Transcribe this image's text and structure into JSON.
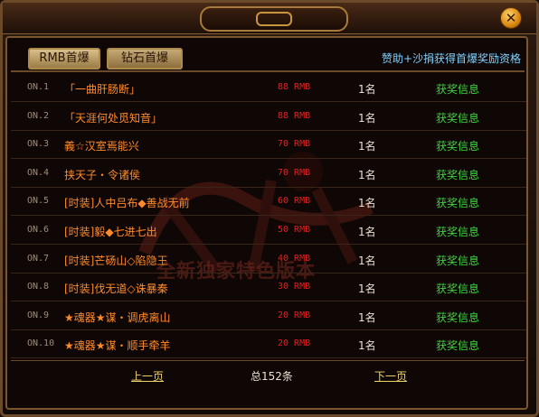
{
  "window": {
    "close_glyph": "✕"
  },
  "tabs": [
    {
      "label": "RMB首爆",
      "active": true
    },
    {
      "label": "钻石首爆",
      "active": false
    }
  ],
  "sponsor_text": "赞助+沙捐获得首爆奖励资格",
  "watermark": "全新独家特色版本",
  "rows": [
    {
      "rank": "ON.1",
      "name": "「一曲肝肠断」",
      "amount": "88 RMB",
      "count": "1名",
      "prize": "获奖信息"
    },
    {
      "rank": "ON.2",
      "name": "「天涯何处觅知音」",
      "amount": "88 RMB",
      "count": "1名",
      "prize": "获奖信息"
    },
    {
      "rank": "ON.3",
      "name": "義☆汉室焉能兴",
      "amount": "70 RMB",
      "count": "1名",
      "prize": "获奖信息"
    },
    {
      "rank": "ON.4",
      "name": "挟天子・令诸侯",
      "amount": "70 RMB",
      "count": "1名",
      "prize": "获奖信息"
    },
    {
      "rank": "ON.5",
      "name": "[时装]人中吕布◆善战无前",
      "amount": "60 RMB",
      "count": "1名",
      "prize": "获奖信息"
    },
    {
      "rank": "ON.6",
      "name": "[时装]毅◆七进七出",
      "amount": "50 RMB",
      "count": "1名",
      "prize": "获奖信息"
    },
    {
      "rank": "ON.7",
      "name": "[时装]芒砀山◇陷隐王",
      "amount": "40 RMB",
      "count": "1名",
      "prize": "获奖信息"
    },
    {
      "rank": "ON.8",
      "name": "[时装]伐无道◇诛暴秦",
      "amount": "30 RMB",
      "count": "1名",
      "prize": "获奖信息"
    },
    {
      "rank": "ON.9",
      "name": "★魂器★谋・调虎离山",
      "amount": "20 RMB",
      "count": "1名",
      "prize": "获奖信息"
    },
    {
      "rank": "ON.10",
      "name": "★魂器★谋・顺手牵羊",
      "amount": "20 RMB",
      "count": "1名",
      "prize": "获奖信息"
    }
  ],
  "pager": {
    "prev": "上一页",
    "total": "总152条",
    "next": "下一页"
  }
}
